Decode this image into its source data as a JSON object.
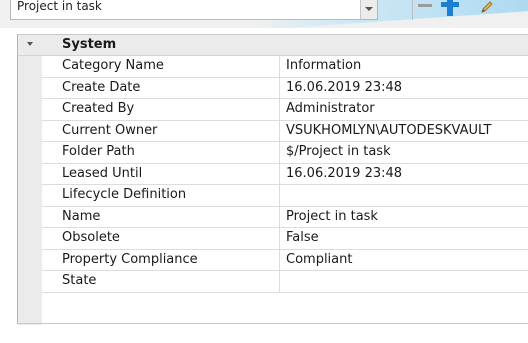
{
  "toolbar": {
    "combo_text": "Project in task",
    "minus_icon": "minus-icon",
    "add_icon": "plus-icon",
    "edit_icon": "pencil-icon"
  },
  "group": {
    "title": "System",
    "icon": "collapse-chevron-icon"
  },
  "properties": [
    {
      "name": "Category Name",
      "value": "Information"
    },
    {
      "name": "Create Date",
      "value": "16.06.2019 23:48"
    },
    {
      "name": "Created By",
      "value": "Administrator"
    },
    {
      "name": "Current Owner",
      "value": "VSUKHOMLYN\\AUTODESKVAULT"
    },
    {
      "name": "Folder Path",
      "value": "$/Project in task"
    },
    {
      "name": "Leased Until",
      "value": "16.06.2019 23:48"
    },
    {
      "name": "Lifecycle Definition",
      "value": ""
    },
    {
      "name": "Name",
      "value": "Project in task"
    },
    {
      "name": "Obsolete",
      "value": "False"
    },
    {
      "name": "Property Compliance",
      "value": "Compliant"
    },
    {
      "name": "State",
      "value": ""
    }
  ],
  "colors": {
    "accent_blue": "#1c7fd6",
    "grid_header": "#ebebeb",
    "grid_line": "#dcdcdc"
  }
}
